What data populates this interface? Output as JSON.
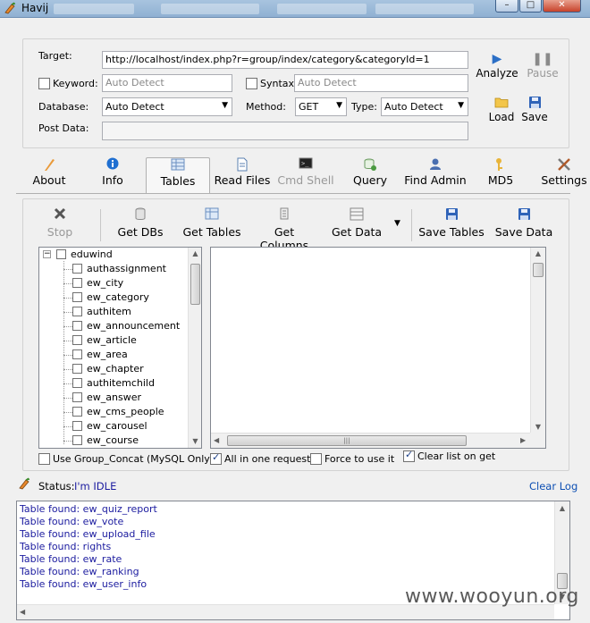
{
  "window": {
    "title": "Havij",
    "minimize_glyph": "–",
    "maximize_glyph": "□",
    "close_glyph": "✕"
  },
  "target_section": {
    "target_label": "Target:",
    "target_value": "http://localhost/index.php?r=group/index/category&categoryId=1",
    "keyword_label": "Keyword:",
    "keyword_placeholder": "Auto Detect",
    "syntax_label": "Syntax:",
    "syntax_placeholder": "Auto Detect",
    "database_label": "Database:",
    "database_value": "Auto Detect",
    "method_label": "Method:",
    "method_value": "GET",
    "type_label": "Type:",
    "type_value": "Auto Detect",
    "post_data_label": "Post Data:",
    "post_data_value": "",
    "analyze_label": "Analyze",
    "pause_label": "Pause",
    "load_label": "Load",
    "save_label": "Save"
  },
  "tabs": [
    {
      "label": "About",
      "icon": "quill-icon"
    },
    {
      "label": "Info",
      "icon": "info-icon"
    },
    {
      "label": "Tables",
      "icon": "table-icon"
    },
    {
      "label": "Read Files",
      "icon": "document-icon"
    },
    {
      "label": "Cmd Shell",
      "icon": "terminal-icon"
    },
    {
      "label": "Query",
      "icon": "query-icon"
    },
    {
      "label": "Find Admin",
      "icon": "admin-icon"
    },
    {
      "label": "MD5",
      "icon": "key-icon"
    },
    {
      "label": "Settings",
      "icon": "tools-icon"
    }
  ],
  "active_tab": "Tables",
  "tables_toolbar": {
    "stop_label": "Stop",
    "get_dbs_label": "Get DBs",
    "get_tables_label": "Get Tables",
    "get_columns_label": "Get Columns",
    "get_data_label": "Get Data",
    "save_tables_label": "Save Tables",
    "save_data_label": "Save Data"
  },
  "tree": {
    "root": "eduwind",
    "root_expander": "−",
    "items": [
      "authassignment",
      "ew_city",
      "ew_category",
      "authitem",
      "ew_announcement",
      "ew_article",
      "ew_area",
      "ew_chapter",
      "authitemchild",
      "ew_answer",
      "ew_cms_people",
      "ew_carousel",
      "ew_course"
    ]
  },
  "options": {
    "group_concat_label": "Use Group_Concat (MySQL Only)",
    "group_concat_checked": false,
    "all_in_one_label": "All in one request.",
    "all_in_one_checked": true,
    "force_label": "Force to use it",
    "force_checked": false,
    "clear_list_label": "Clear list on get",
    "clear_list_checked": true
  },
  "status": {
    "label": "Status:",
    "value": "I'm IDLE",
    "clear_log_label": "Clear Log"
  },
  "log_lines": [
    "Table found: ew_quiz_report",
    "Table found: ew_vote",
    "Table found: ew_upload_file",
    "Table found: rights",
    "Table found: ew_rate",
    "Table found: ew_ranking",
    "Table found: ew_user_info"
  ],
  "watermark": "www.wooyun.org",
  "colors": {
    "accent_blue": "#1b1b9f",
    "link_blue": "#0d4fb3",
    "titlebar": "#a8c4df"
  }
}
